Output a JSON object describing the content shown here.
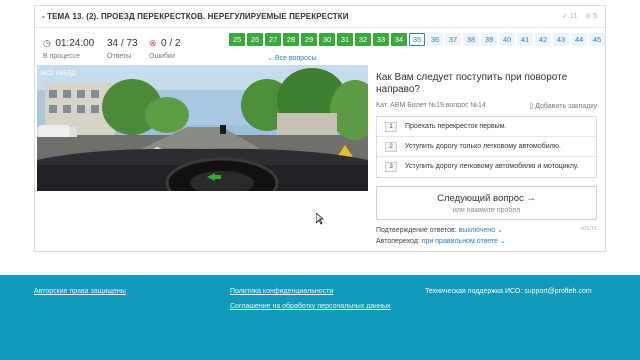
{
  "header": {
    "title": "- ТЕМА 13. (2). ПРОЕЗД ПЕРЕКРЕСТКОВ. НЕРЕГУЛИРУЕМЫЕ ПЕРЕКРЕСТКИ",
    "correct_count": "11",
    "error_count": "5"
  },
  "stats": {
    "time": "01:24:00",
    "time_label": "В процессе",
    "answers": "34 / 73",
    "answers_label": "Ответы",
    "errors": "0 / 2",
    "errors_label": "Ошибки"
  },
  "question_numbers": [
    {
      "label": "25",
      "state": "done"
    },
    {
      "label": "26",
      "state": "done"
    },
    {
      "label": "27",
      "state": "done"
    },
    {
      "label": "28",
      "state": "done"
    },
    {
      "label": "29",
      "state": "done"
    },
    {
      "label": "30",
      "state": "done"
    },
    {
      "label": "31",
      "state": "done"
    },
    {
      "label": "32",
      "state": "done"
    },
    {
      "label": "33",
      "state": "done"
    },
    {
      "label": "34",
      "state": "done"
    },
    {
      "label": "35",
      "state": "current"
    },
    {
      "label": "36",
      "state": "todo"
    },
    {
      "label": "37",
      "state": "todo"
    },
    {
      "label": "38",
      "state": "todo"
    },
    {
      "label": "39",
      "state": "todo"
    },
    {
      "label": "40",
      "state": "todo"
    },
    {
      "label": "41",
      "state": "todo"
    },
    {
      "label": "42",
      "state": "todo"
    },
    {
      "label": "43",
      "state": "todo"
    },
    {
      "label": "44",
      "state": "todo"
    },
    {
      "label": "45",
      "state": "todo"
    }
  ],
  "all_questions_label": "Все вопросы",
  "photo": {
    "watermark": "ИСО ГИБДД"
  },
  "question": {
    "text": "Как Вам следует поступить при повороте направо?",
    "meta": "Кат. ABM  Билет №19  вопрос №14",
    "bookmark_label": "Добавить закладку"
  },
  "answers": [
    {
      "num": "1",
      "text": "Проехать перекресток первым."
    },
    {
      "num": "2",
      "text": "Уступить дорогу только легковому автомобилю."
    },
    {
      "num": "3",
      "text": "Уступить дорогу легковому автомобилю и мотоциклу."
    }
  ],
  "next_button": {
    "label": "Следующий вопрос →",
    "sub": "или нажмите пробел"
  },
  "version": "v01/71",
  "options": {
    "confirm_label": "Подтверждение ответов:",
    "confirm_value": "выключено",
    "autonext_label": "Автопереход:",
    "autonext_value": "при правильном ответе"
  },
  "footer": {
    "copyright": "Авторские права защищены",
    "privacy": "Политика конфиденциальности",
    "agreement": "Соглашение на обработку персональных данных",
    "support": "Техническая поддержка ИСО:  support@profteh.com"
  },
  "colors": {
    "done": "#3aa83a",
    "accent": "#2d7fc0",
    "footer": "#1199bb",
    "error": "#d9534f"
  }
}
